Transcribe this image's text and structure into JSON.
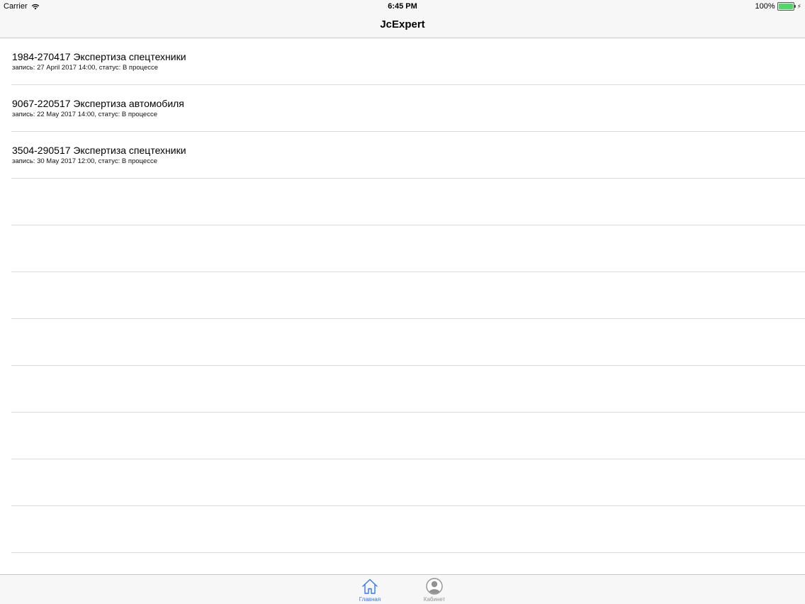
{
  "status_bar": {
    "carrier": "Carrier",
    "time": "6:45 PM",
    "battery_percent": "100%",
    "battery_level": 1.0,
    "battery_color": "#4cd964"
  },
  "nav": {
    "title": "JcExpert"
  },
  "list": {
    "items": [
      {
        "title": "1984-270417 Экспертиза спецтехники",
        "subtitle": "запись: 27 April 2017 14:00, статус: В процессе"
      },
      {
        "title": "9067-220517 Экспертиза автомобиля",
        "subtitle": "запись: 22 May 2017 14:00, статус: В процессе"
      },
      {
        "title": "3504-290517 Экспертиза спецтехники",
        "subtitle": "запись: 30 May 2017 12:00, статус: В процессе"
      }
    ]
  },
  "tab_bar": {
    "accent_color": "#3478f6",
    "inactive_color": "#929292",
    "tabs": [
      {
        "label": "Главная",
        "icon": "home-icon",
        "selected": true
      },
      {
        "label": "Кабинет",
        "icon": "user-icon",
        "selected": false
      }
    ]
  }
}
